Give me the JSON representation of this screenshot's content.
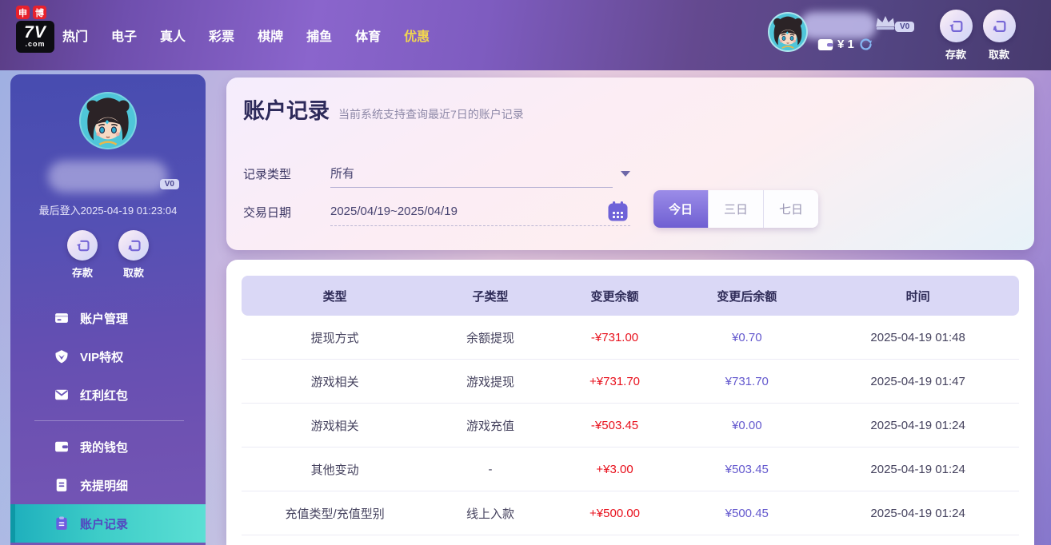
{
  "topbar": {
    "logo": {
      "badge1": "申",
      "badge2": "博",
      "main": "7V",
      "suffix": ".com"
    },
    "nav": [
      {
        "label": "热门"
      },
      {
        "label": "电子"
      },
      {
        "label": "真人"
      },
      {
        "label": "彩票"
      },
      {
        "label": "棋牌"
      },
      {
        "label": "捕鱼"
      },
      {
        "label": "体育"
      },
      {
        "label": "优惠"
      }
    ],
    "balance": "¥ 1",
    "vip_level": "V0",
    "deposit_label": "存款",
    "withdraw_label": "取款"
  },
  "sidebar": {
    "vip_level": "V0",
    "last_login": "最后登入2025-04-19 01:23:04",
    "deposit_label": "存款",
    "withdraw_label": "取款",
    "menu": [
      {
        "label": "账户管理"
      },
      {
        "label": "VIP特权"
      },
      {
        "label": "红利红包"
      },
      {
        "label": "我的钱包"
      },
      {
        "label": "充提明细"
      },
      {
        "label": "账户记录"
      }
    ]
  },
  "main": {
    "title": "账户记录",
    "subtitle": "当前系统支持查询最近7日的账户记录",
    "filters": {
      "record_type_label": "记录类型",
      "record_type_value": "所有",
      "date_label": "交易日期",
      "date_value": "2025/04/19~2025/04/19"
    },
    "range_tabs": [
      {
        "label": "今日",
        "active": true
      },
      {
        "label": "三日",
        "active": false
      },
      {
        "label": "七日",
        "active": false
      }
    ]
  },
  "table": {
    "headers": [
      "类型",
      "子类型",
      "变更余额",
      "变更后余额",
      "时间"
    ],
    "rows": [
      {
        "type": "提现方式",
        "subtype": "余额提现",
        "change": "-¥731.00",
        "balance": "¥0.70",
        "time": "2025-04-19 01:48"
      },
      {
        "type": "游戏相关",
        "subtype": "游戏提现",
        "change": "+¥731.70",
        "balance": "¥731.70",
        "time": "2025-04-19 01:47"
      },
      {
        "type": "游戏相关",
        "subtype": "游戏充值",
        "change": "-¥503.45",
        "balance": "¥0.00",
        "time": "2025-04-19 01:24"
      },
      {
        "type": "其他变动",
        "subtype": "-",
        "change": "+¥3.00",
        "balance": "¥503.45",
        "time": "2025-04-19 01:24"
      },
      {
        "type": "充值类型/充值型别",
        "subtype": "线上入款",
        "change": "+¥500.00",
        "balance": "¥500.45",
        "time": "2025-04-19 01:24"
      }
    ]
  },
  "colors": {
    "change_red": "#e8101c",
    "balance_purple": "#6459ce",
    "active_teal": "#3ecdc8",
    "nav_highlight_yellow": "#f0d451",
    "topbar_purple": "#7e5cc0"
  }
}
